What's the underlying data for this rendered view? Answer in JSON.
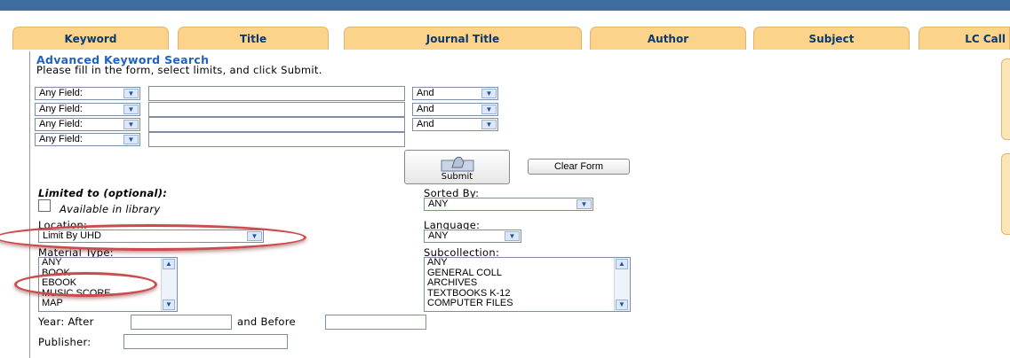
{
  "tabs": [
    "Keyword",
    "Title",
    "Journal Title",
    "Author",
    "Subject",
    "LC Call"
  ],
  "form": {
    "heading": "Advanced Keyword Search",
    "instructions": "Please fill in the form, select limits, and click Submit.",
    "field_rows": [
      {
        "field": "Any Field:",
        "operator": "And"
      },
      {
        "field": "Any Field:",
        "operator": "And"
      },
      {
        "field": "Any Field:",
        "operator": "And"
      },
      {
        "field": "Any Field:"
      }
    ],
    "submit_label": "Submit",
    "clear_label": "Clear Form"
  },
  "limits": {
    "title": "Limited to (optional):",
    "available_label": "Available in library",
    "location_label": "Location:",
    "location_value": "Limit By UHD",
    "material_label": "Material Type:",
    "material_options": [
      "ANY",
      "BOOK",
      "EBOOK",
      "MUSIC SCORE",
      "MAP"
    ],
    "sorted_label": "Sorted By:",
    "sorted_value": "ANY",
    "language_label": "Language:",
    "language_value": "ANY",
    "subcollection_label": "Subcollection:",
    "subcollection_options": [
      "ANY",
      "GENERAL COLL",
      "ARCHIVES",
      "TEXTBOOKS K-12",
      "COMPUTER FILES"
    ],
    "year_after_label": "Year: After",
    "year_before_label": "and Before",
    "publisher_label": "Publisher:"
  },
  "colors": {
    "topbar": "#3c6d9e",
    "tab": "#fbd38a",
    "heading": "#1f63c1",
    "highlight": "#c94b4b"
  },
  "icons": {
    "select_arrow": "chevron-down-icon",
    "submit": "submit-hand-icon"
  }
}
